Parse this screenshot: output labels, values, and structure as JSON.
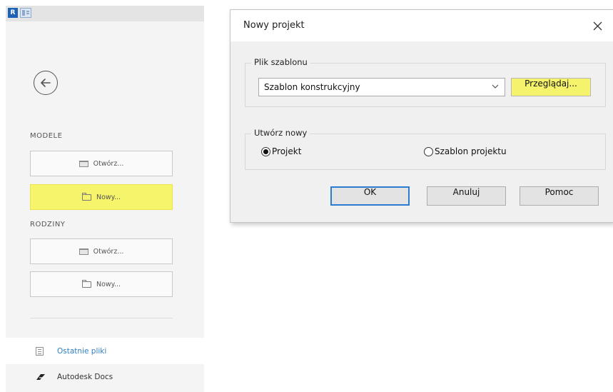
{
  "left_panel": {
    "logo_letter": "R",
    "sections": {
      "models": {
        "label": "MODELE",
        "open_label": "Otwórz...",
        "new_label": "Nowy..."
      },
      "families": {
        "label": "RODZINY",
        "open_label": "Otwórz...",
        "new_label": "Nowy..."
      }
    },
    "recent_files": "Ostatnie pliki",
    "autodesk_docs": "Autodesk Docs"
  },
  "dialog": {
    "title": "Nowy projekt",
    "template_group": {
      "title": "Plik szablonu",
      "selected_template": "Szablon konstrukcyjny",
      "browse_label": "Przeglądaj..."
    },
    "create_group": {
      "title": "Utwórz nowy",
      "options": [
        {
          "label": "Projekt",
          "checked": true
        },
        {
          "label": "Szablon projektu",
          "checked": false
        }
      ]
    },
    "buttons": {
      "ok": "OK",
      "cancel": "Anuluj",
      "help": "Pomoc"
    }
  },
  "colors": {
    "highlight": "#f5f36b",
    "link": "#2f7fc1",
    "revit_blue": "#1e62b8"
  }
}
